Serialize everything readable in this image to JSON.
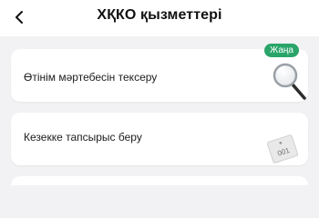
{
  "header": {
    "back_icon": "chevron-left-icon",
    "title": "ХҚКО қызметтері"
  },
  "services": [
    {
      "label": "Өтінім мәртебесін тексеру",
      "badge": "Жаңа",
      "icon": "magnifier-icon"
    },
    {
      "label": "Кезекке тапсырыс беру",
      "icon": "queue-ticket-icon",
      "ticket_number": "001"
    }
  ],
  "colors": {
    "badge": "#2aa56a",
    "background": "#f2f2f4",
    "card": "#ffffff"
  }
}
